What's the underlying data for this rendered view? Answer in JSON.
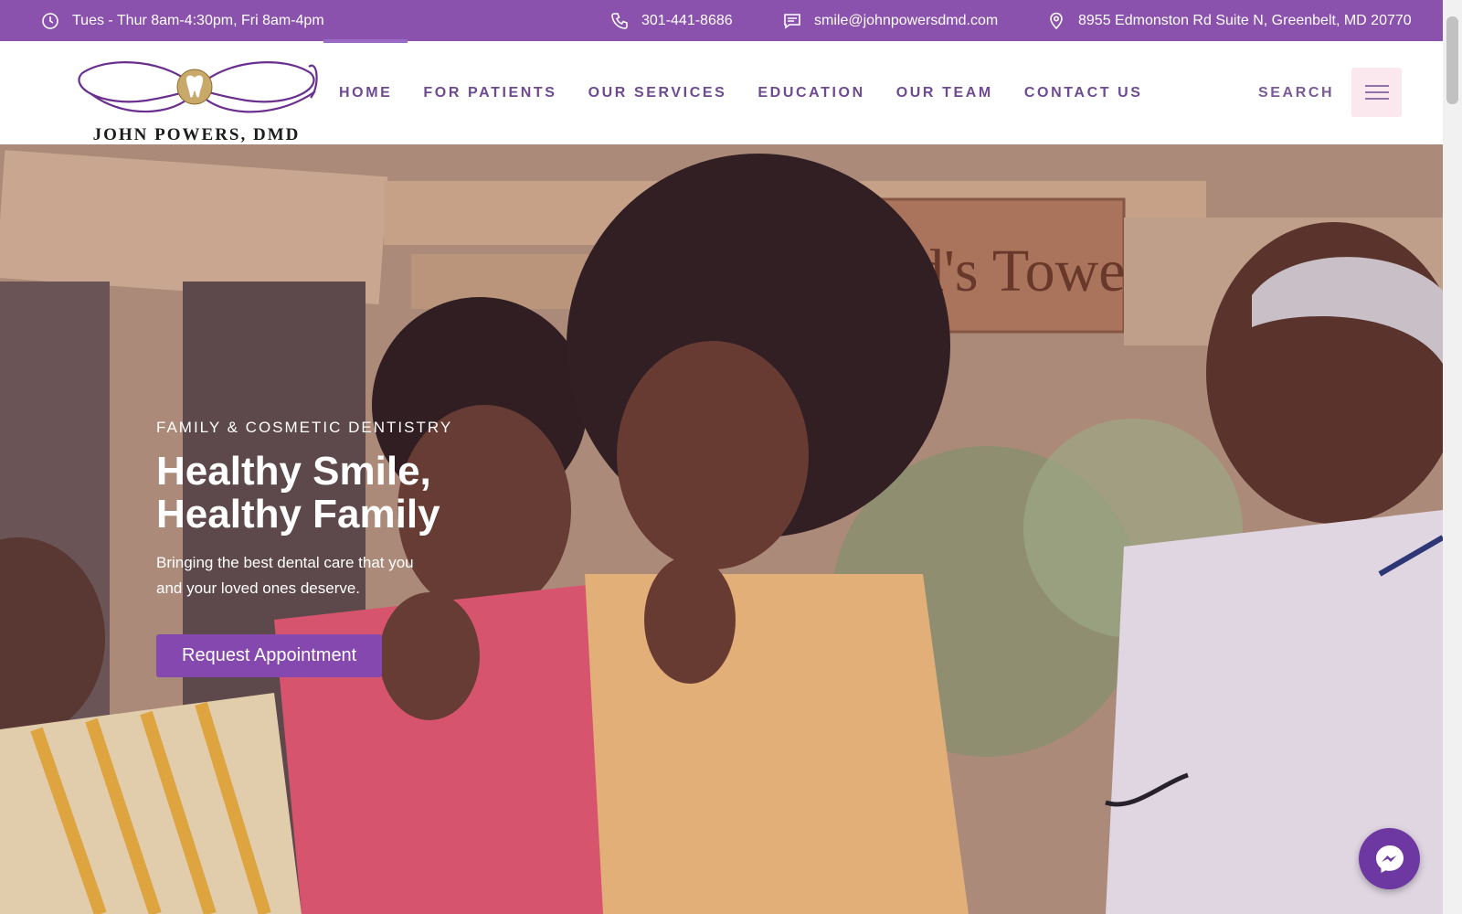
{
  "topbar": {
    "hours": "Tues - Thur 8am-4:30pm, Fri 8am-4pm",
    "phone": "301-441-8686",
    "email": "smile@johnpowersdmd.com",
    "address": "8955 Edmonston Rd Suite N, Greenbelt, MD 20770",
    "icons": [
      "clock-icon",
      "phone-icon",
      "message-icon",
      "location-pin-icon"
    ]
  },
  "header": {
    "logo_text": "JOHN POWERS, DMD",
    "nav": [
      {
        "label": "HOME",
        "active": true
      },
      {
        "label": "FOR PATIENTS",
        "active": false
      },
      {
        "label": "OUR SERVICES",
        "active": false
      },
      {
        "label": "EDUCATION",
        "active": false
      },
      {
        "label": "OUR TEAM",
        "active": false
      },
      {
        "label": "CONTACT US",
        "active": false
      }
    ],
    "search_label": "SEARCH",
    "menu_icon": "hamburger-menu-icon"
  },
  "hero": {
    "eyebrow": "FAMILY & COSMETIC DENTISTRY",
    "headline": "Healthy Smile, Healthy Family",
    "subtext": "Bringing the best dental care that you and your loved ones deserve.",
    "cta_label": "Request Appointment",
    "sign_text": "Ted's Tower"
  },
  "messenger": {
    "icon": "messenger-icon"
  },
  "colors": {
    "brand_purple": "#8a52ad",
    "nav_text": "#6e4a91",
    "cta": "#8448ae",
    "menu_button_bg": "#fbe7ee"
  }
}
